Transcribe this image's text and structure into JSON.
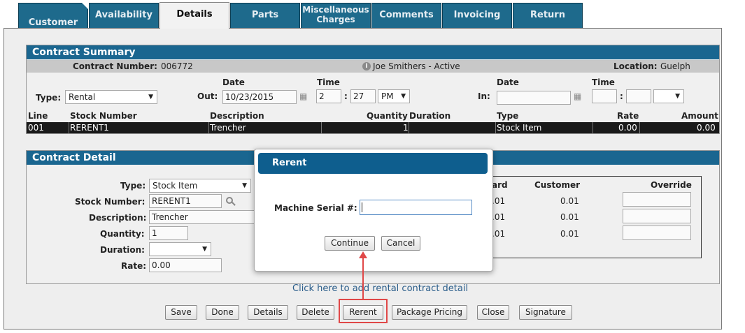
{
  "tabs": [
    {
      "label": "Customer"
    },
    {
      "label": "Availability"
    },
    {
      "label": "Details"
    },
    {
      "label": "Parts"
    },
    {
      "label": "Miscellaneous Charges"
    },
    {
      "label": "Comments"
    },
    {
      "label": "Invoicing"
    },
    {
      "label": "Return"
    }
  ],
  "summary": {
    "title": "Contract Summary",
    "contract_number_label": "Contract Number:",
    "contract_number": "006772",
    "customer_status": "Joe Smithers - Active",
    "location_label": "Location:",
    "location": "Guelph",
    "date_label": "Date",
    "time_label": "Time",
    "type_label": "Type:",
    "type_value": "Rental",
    "out_label": "Out:",
    "out_date": "10/23/2015",
    "out_hour": "2",
    "out_minute": "27",
    "out_ampm": "PM",
    "in_label": "In:",
    "in_date_label": "Date",
    "in_time_label": "Time",
    "columns": [
      "Line",
      "Stock Number",
      "Description",
      "Quantity",
      "Duration",
      "Type",
      "Rate",
      "Amount"
    ],
    "rows": [
      {
        "line": "001",
        "stock": "RERENT1",
        "description": "Trencher",
        "quantity": "1",
        "duration": "",
        "type": "Stock Item",
        "rate": "0.00",
        "amount": "0.00"
      }
    ]
  },
  "detail": {
    "title": "Contract Detail",
    "type_label": "Type:",
    "type_value": "Stock Item",
    "stock_label": "Stock Number:",
    "stock_value": "RERENT1",
    "description_label": "Description:",
    "description_value": "Trencher",
    "quantity_label": "Quantity:",
    "quantity_value": "1",
    "duration_label": "Duration:",
    "rate_label": "Rate:",
    "rate_value": "0.00",
    "rate_table": {
      "col_standard_partial": "ard",
      "col_customer": "Customer",
      "col_override": "Override",
      "rows": [
        {
          "standard": ".01",
          "customer": "0.01"
        },
        {
          "standard": ".01",
          "customer": "0.01"
        },
        {
          "standard": ".01",
          "customer": "0.01"
        }
      ]
    }
  },
  "add_link": "Click here to add rental contract detail",
  "buttons": {
    "save": "Save",
    "done": "Done",
    "details": "Details",
    "delete": "Delete",
    "rerent": "Rerent",
    "package_pricing": "Package Pricing",
    "close": "Close",
    "signature": "Signature"
  },
  "modal": {
    "title": "Rerent",
    "serial_label": "Machine Serial #:",
    "serial_value": "",
    "continue": "Continue",
    "cancel": "Cancel"
  },
  "colors": {
    "tab_bg": "#1e6a8c",
    "header_bg": "#1a6690",
    "highlight": "#e04848"
  }
}
